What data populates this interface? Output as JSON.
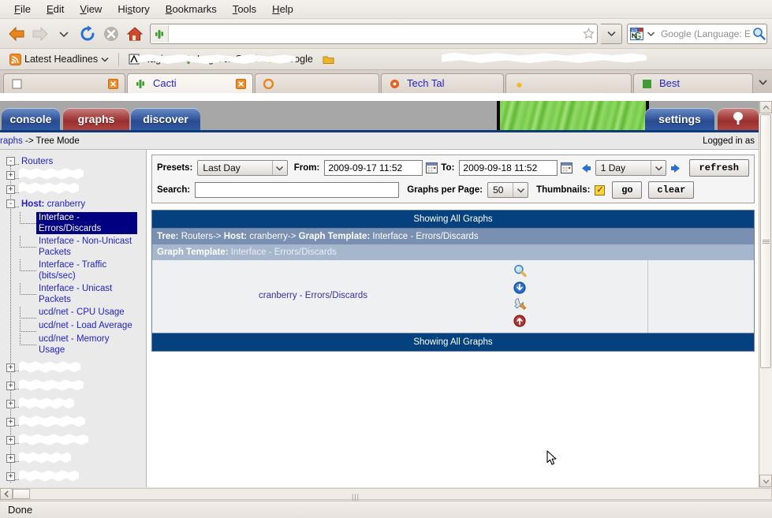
{
  "browser": {
    "menus": [
      "File",
      "Edit",
      "View",
      "History",
      "Bookmarks",
      "Tools",
      "Help"
    ],
    "nav": {
      "back_icon": "back-arrow-icon",
      "forward_icon": "forward-arrow-icon",
      "history_icon": "chevron-down-icon",
      "reload_icon": "reload-icon",
      "stop_icon": "stop-icon",
      "home_icon": "home-icon",
      "site_icon": "cacti-favicon",
      "url_value": "",
      "bookmark_star_icon": "star-icon",
      "urlbar_dropdown_icon": "chevron-down-icon"
    },
    "search": {
      "engine_icon": "en-language-icon",
      "engine_dropdown_icon": "chevron-down-icon",
      "placeholder": "Google (Language: E",
      "search_icon": "search-icon"
    },
    "bookmarks": {
      "feed_label": "Latest Headlines",
      "feed_icon": "rss-icon",
      "feed_dropdown_icon": "chevron-down-icon",
      "items": [
        {
          "label": "Nagios",
          "icon": "nagios-favicon"
        },
        {
          "label": "Login to Cacti",
          "icon": "cacti-favicon"
        },
        {
          "label": "Google",
          "icon": "google-favicon"
        },
        {
          "label": "",
          "icon": "folder-icon"
        }
      ]
    },
    "tabs": [
      {
        "label": "",
        "icon": "page-favicon",
        "active": false,
        "close_icon": "close-icon"
      },
      {
        "label": "Cacti",
        "icon": "cacti-favicon",
        "active": true,
        "close_icon": "close-icon"
      },
      {
        "label": "",
        "icon": "google-favicon",
        "active": false,
        "close_icon": "close-icon"
      },
      {
        "label": "Tech Tal",
        "icon": "techtalk-favicon",
        "active": false,
        "close_icon": "close-icon"
      },
      {
        "label": "",
        "icon": "page-favicon",
        "active": false,
        "close_icon": "close-icon"
      },
      {
        "label": "Best",
        "icon": "page-favicon",
        "active": false,
        "close_icon": "close-icon"
      }
    ],
    "tab_list_icon": "chevron-down-icon",
    "status": "Done"
  },
  "cacti": {
    "tabs": [
      {
        "label": "console",
        "color": "blue"
      },
      {
        "label": "graphs",
        "color": "red"
      },
      {
        "label": "discover",
        "color": "blue"
      },
      {
        "label": "settings",
        "color": "blue"
      }
    ],
    "tree_tab_icon": "tree-icon",
    "breadcrumb": {
      "link": "raphs",
      "separator": "->",
      "current": "Tree Mode"
    },
    "login_status": "Logged in as",
    "filter": {
      "presets_label": "Presets:",
      "presets_value": "Last Day",
      "from_label": "From:",
      "from_value": "2009-09-17 11:52",
      "to_label": "To:",
      "to_value": "2009-09-18 11:52",
      "calendar_icon": "calendar-icon",
      "prev_icon": "left-arrow-icon",
      "next_icon": "right-arrow-icon",
      "span_value": "1 Day",
      "refresh_label": "refresh",
      "search_label": "Search:",
      "search_value": "",
      "graphs_per_page_label": "Graphs per Page:",
      "graphs_per_page_value": "50",
      "thumbnails_label": "Thumbnails:",
      "thumbnails_checked": "✓",
      "go_label": "go",
      "clear_label": "clear",
      "dropdown_icon": "chevron-down-icon"
    },
    "results": {
      "header": "Showing All Graphs",
      "footer": "Showing All Graphs",
      "tree_row": {
        "tree_label": "Tree:",
        "tree_value": "Routers->",
        "host_label": "Host:",
        "host_value": "cranberry->",
        "template_label": "Graph Template:",
        "template_value": "Interface - Errors/Discards"
      },
      "template_row": {
        "label": "Graph Template:",
        "value": "Interface - Errors/Discards"
      },
      "graph": {
        "title": "cranberry - Errors/Discards",
        "icons": [
          {
            "name": "zoom-icon"
          },
          {
            "name": "csv-export-icon"
          },
          {
            "name": "graph-properties-icon"
          },
          {
            "name": "page-top-icon"
          }
        ]
      }
    },
    "tree": {
      "root": {
        "label": "Routers",
        "expanded": true,
        "toggle": "-"
      },
      "nodes": [
        {
          "label": "",
          "toggle": "+",
          "redacted": true,
          "indent": 1
        },
        {
          "label": "",
          "toggle": "+",
          "redacted": true,
          "indent": 1
        },
        {
          "label_bold": "Host:",
          "label": "cranberry",
          "toggle": "-",
          "indent": 1,
          "expanded": true
        }
      ],
      "leaves": [
        {
          "label": "Interface - Errors/Discards",
          "selected": true
        },
        {
          "label": "Interface - Non-Unicast Packets",
          "selected": false
        },
        {
          "label": "Interface - Traffic (bits/sec)",
          "selected": false
        },
        {
          "label": "Interface - Unicast Packets",
          "selected": false
        },
        {
          "label": "ucd/net - CPU Usage",
          "selected": false
        },
        {
          "label": "ucd/net - Load Average",
          "selected": false
        },
        {
          "label": "ucd/net - Memory Usage",
          "selected": false
        }
      ],
      "collapsed_nodes": [
        {
          "toggle": "+",
          "redacted": true
        },
        {
          "toggle": "+",
          "redacted": true
        },
        {
          "toggle": "+",
          "redacted": true
        },
        {
          "toggle": "+",
          "redacted": true
        },
        {
          "toggle": "+",
          "redacted": true
        },
        {
          "toggle": "+",
          "redacted": true
        },
        {
          "toggle": "+",
          "redacted": true
        },
        {
          "toggle": "+",
          "redacted": true
        }
      ]
    }
  },
  "colors": {
    "header_blue": "#05417e",
    "row_mid": "#7a90b2",
    "row_light": "#a6b6cd",
    "link_blue": "#2222cc",
    "selection": "#000080",
    "tab_red": "#97302f",
    "tab_blue": "#2b4b8e"
  }
}
